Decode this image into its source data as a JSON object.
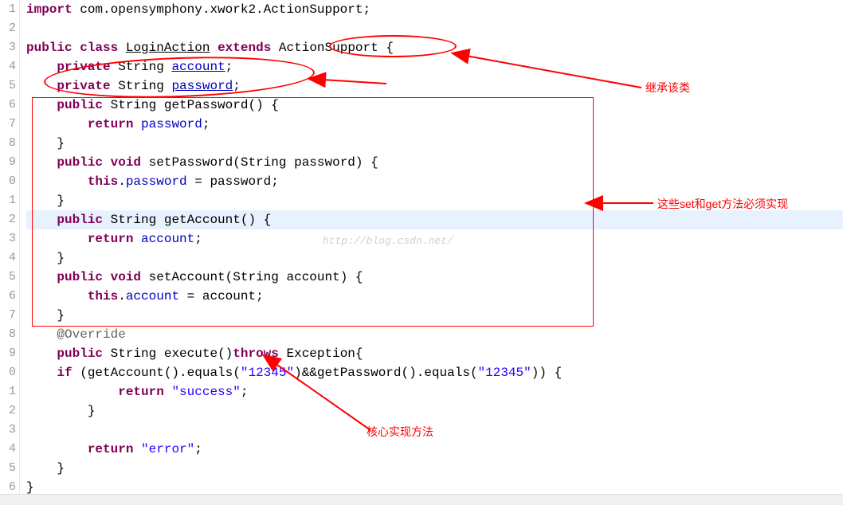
{
  "gutter": [
    "1",
    "2",
    "3",
    "4",
    "5",
    "6",
    "7",
    "8",
    "9",
    "0",
    "1",
    "2",
    "3",
    "4",
    "5",
    "6",
    "7",
    "8",
    "9",
    "0",
    "1",
    "2",
    "3",
    "4",
    "5",
    "6"
  ],
  "tokens": {
    "import": "import",
    "public": "public",
    "class": "class",
    "extends": "extends",
    "private": "private",
    "void": "void",
    "return": "return",
    "this": "this",
    "throws": "throws",
    "if": "if"
  },
  "code": {
    "import_stmt": " com.opensymphony.xwork2.ActionSupport;",
    "class_name": "LoginAction",
    "extends_name": "ActionSupport",
    "string_type": "String",
    "field_account": "account",
    "field_password": "password",
    "getPassword": "getPassword",
    "setPassword": "setPassword",
    "getAccount": "getAccount",
    "setAccount": "setAccount",
    "param_password": "password",
    "param_account": "account",
    "override": "@Override",
    "execute": "execute",
    "exception": "Exception",
    "cond_getAccount": "getAccount",
    "cond_equals": "equals",
    "cond_getPassword": "getPassword",
    "str_12345": "\"12345\"",
    "str_success": "\"success\"",
    "str_error": "\"error\"",
    "semicolon": ";",
    "lbrace": "{",
    "rbrace": "}",
    "lparen": "(",
    "rparen": ")",
    "dot": ".",
    "eq": " = ",
    "amp": "&&"
  },
  "annotations": {
    "extends_note": "继承该类",
    "getset_note": "这些set和get方法必须实现",
    "core_note": "核心实现方法"
  },
  "watermark": "http://blog.csdn.net/"
}
